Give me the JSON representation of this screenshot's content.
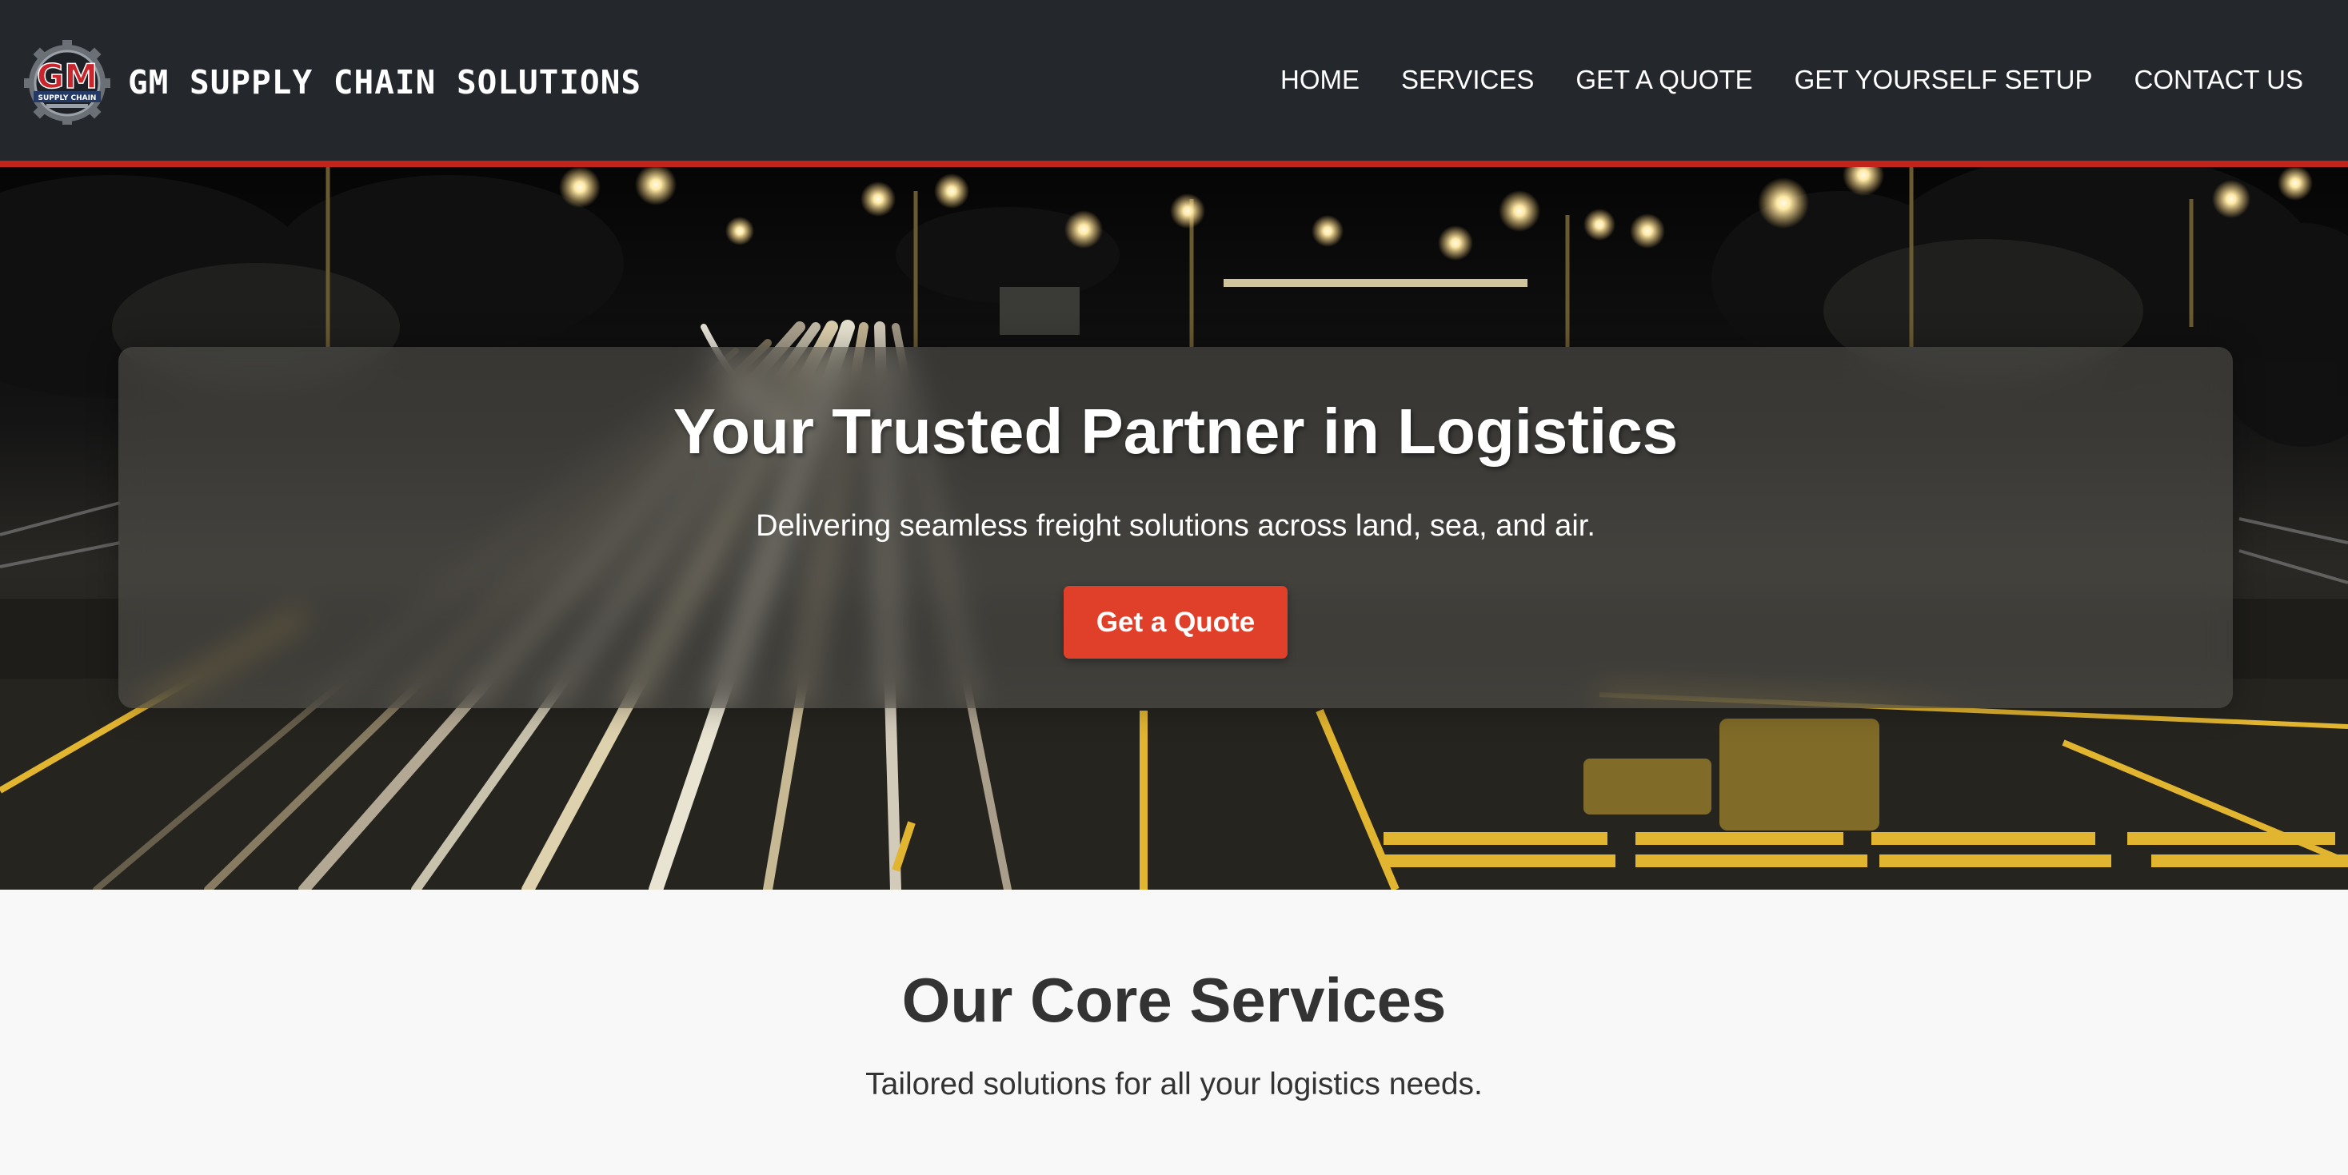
{
  "header": {
    "brand_name": "GM SUPPLY CHAIN SOLUTIONS",
    "logo": {
      "icon": "gm-shield-logo",
      "monogram": "GM",
      "caption": "SUPPLY CHAIN"
    },
    "nav": [
      {
        "label": "HOME"
      },
      {
        "label": "SERVICES"
      },
      {
        "label": "GET A QUOTE"
      },
      {
        "label": "GET YOURSELF SETUP"
      },
      {
        "label": "CONTACT US"
      }
    ],
    "colors": {
      "background": "#24272c",
      "accent_border": "#c0241b"
    }
  },
  "hero": {
    "title": "Your Trusted Partner in Logistics",
    "subtitle": "Delivering seamless freight solutions across land, sea, and air.",
    "cta_label": "Get a Quote",
    "background_image": "night highway with long-exposure light trails and street lamps",
    "colors": {
      "cta": "#e0402a",
      "road_lines": "#e2b530"
    }
  },
  "services": {
    "title": "Our Core Services",
    "subtitle": "Tailored solutions for all your logistics needs."
  }
}
